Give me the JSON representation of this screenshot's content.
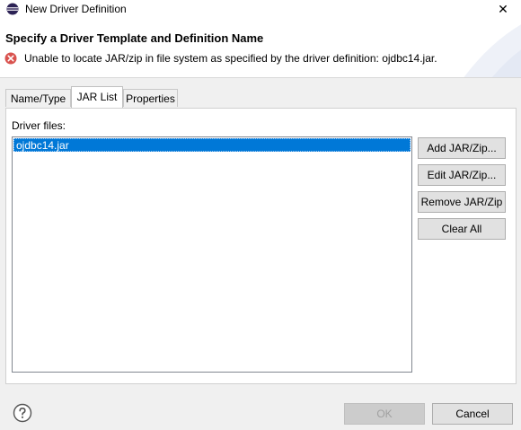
{
  "window": {
    "title": "New Driver Definition",
    "close_glyph": "✕"
  },
  "header": {
    "title": "Specify a Driver Template and Definition Name",
    "error_message": "Unable to locate JAR/zip in file system as specified by the driver definition: ojdbc14.jar."
  },
  "tabs": [
    {
      "label": "Name/Type",
      "active": false
    },
    {
      "label": "JAR List",
      "active": true
    },
    {
      "label": "Properties",
      "active": false
    }
  ],
  "jar_list": {
    "label": "Driver files:",
    "files": [
      "ojdbc14.jar"
    ],
    "selected_index": 0
  },
  "side_buttons": {
    "add": "Add JAR/Zip...",
    "edit": "Edit JAR/Zip...",
    "remove": "Remove JAR/Zip",
    "clear": "Clear All"
  },
  "footer": {
    "ok": "OK",
    "cancel": "Cancel",
    "ok_enabled": false
  },
  "colors": {
    "selection": "#0078d7",
    "error": "#d9534f",
    "eclipse_purple": "#2c2255"
  },
  "icons": {
    "app": "eclipse-icon",
    "error": "error-icon",
    "help": "help-icon"
  }
}
